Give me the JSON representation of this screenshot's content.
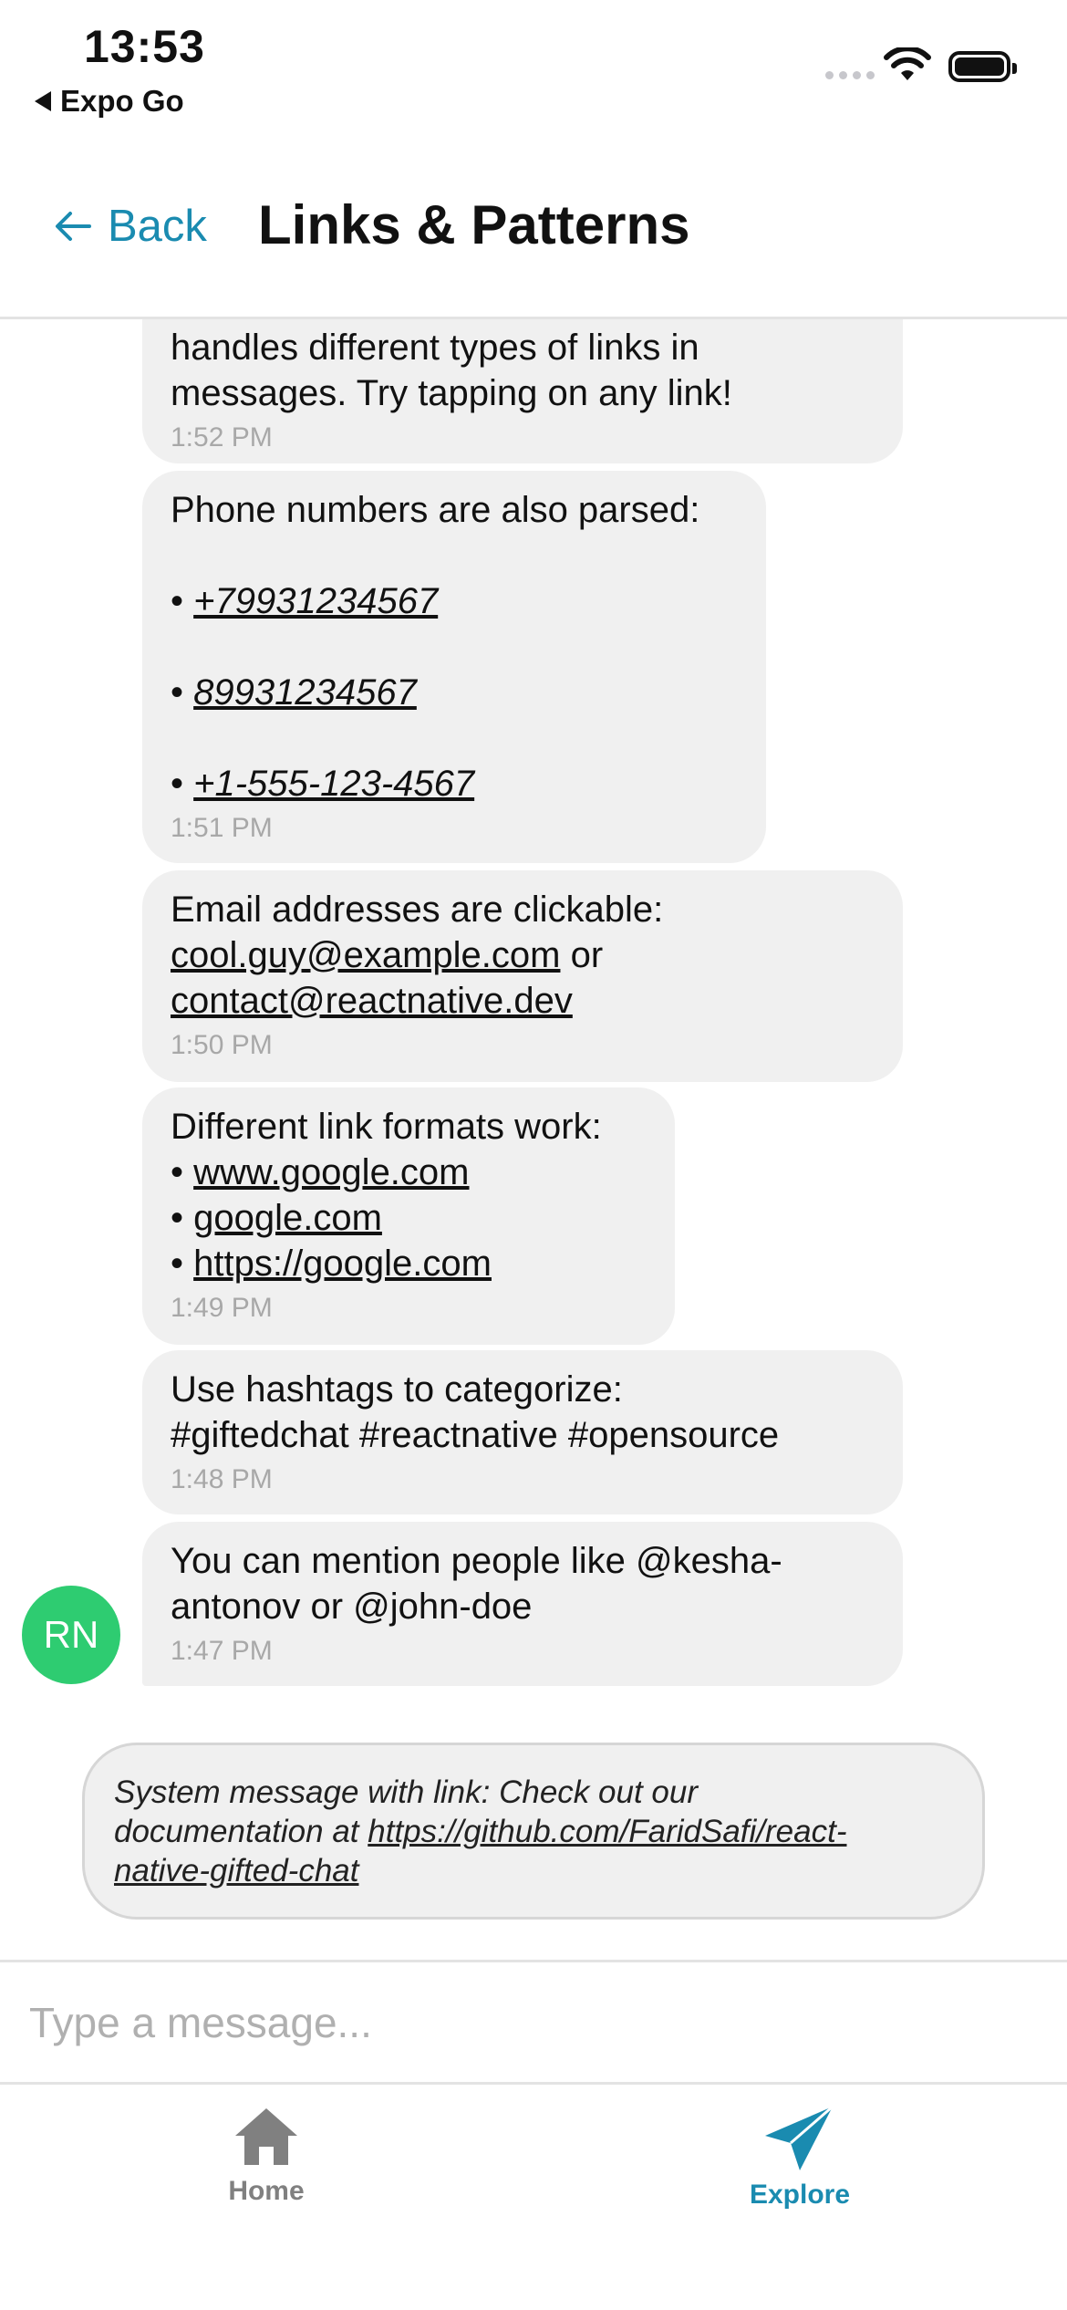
{
  "status_bar": {
    "time": "13:53",
    "back_app": "Expo Go"
  },
  "header": {
    "back_label": "Back",
    "title": "Links & Patterns"
  },
  "messages": [
    {
      "lines": [
        "handles different types of links in",
        "messages. Try tapping on any link!"
      ],
      "time": "1:52 PM"
    },
    {
      "intro": "Phone numbers are also parsed:",
      "phones": [
        "+79931234567",
        "89931234567",
        "+1-555-123-4567"
      ],
      "time": "1:51 PM"
    },
    {
      "intro": "Email addresses are clickable:",
      "email_1": "cool.guy@example.com",
      "joiner": " or",
      "email_2": "contact@reactnative.dev",
      "time": "1:50 PM"
    },
    {
      "intro": "Different link formats work:",
      "links": [
        "www.google.com",
        "google.com",
        "https://google.com"
      ],
      "time": "1:49 PM"
    },
    {
      "lines": [
        "Use hashtags to categorize:",
        "#giftedchat #reactnative #opensource"
      ],
      "time": "1:48 PM"
    },
    {
      "lines": [
        "You can mention people like @kesha-",
        "antonov or @john-doe"
      ],
      "time": "1:47 PM"
    }
  ],
  "avatar": {
    "initials": "RN",
    "color": "#2ecc71"
  },
  "system_message": {
    "prefix_1": "System message with link: Check out our",
    "prefix_2": "documentation at ",
    "link_1": "https://github.com/FaridSafi/react-",
    "link_2": "native-gifted-chat"
  },
  "composer": {
    "placeholder": "Type a message..."
  },
  "tabs": [
    {
      "label": "Home",
      "icon": "home-icon",
      "active": false,
      "color": "#808080"
    },
    {
      "label": "Explore",
      "icon": "paper-plane-icon",
      "active": true,
      "color": "#1a8bb0"
    }
  ],
  "colors": {
    "accent": "#1a8bb0",
    "bubble": "#f0f0f0",
    "timestamp": "#a8a8a8"
  }
}
